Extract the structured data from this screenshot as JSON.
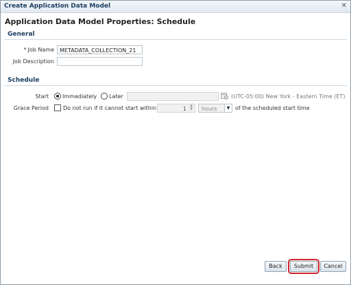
{
  "window": {
    "title": "Create Application Data Model",
    "close_glyph": "✕"
  },
  "page": {
    "title": "Application Data Model Properties: Schedule"
  },
  "general": {
    "header": "General",
    "required_marker": "*",
    "job_name_label": "Job Name",
    "job_name_value": "METADATA_COLLECTION_21",
    "job_description_label": "Job Description",
    "job_description_value": ""
  },
  "schedule": {
    "header": "Schedule",
    "start_label": "Start",
    "immediately_label": "Immediately",
    "later_label": "Later",
    "start_selected": "Immediately",
    "timezone": "(UTC-05:00) New York - Eastern Time (ET)",
    "grace_period_label": "Grace Period",
    "grace_checkbox_label": "Do not run if it cannot start within",
    "grace_checked": false,
    "grace_value": "1",
    "grace_unit": "hours",
    "grace_suffix": "of the scheduled start time"
  },
  "icons": {
    "calendar": "calendar-icon",
    "dropdown": "chevron-down-icon",
    "close": "close-icon"
  },
  "buttons": {
    "back": "Back",
    "submit": "Submit",
    "cancel": "Cancel"
  },
  "colors": {
    "header_text": "#1d3f62",
    "highlight": "#d0242b"
  }
}
